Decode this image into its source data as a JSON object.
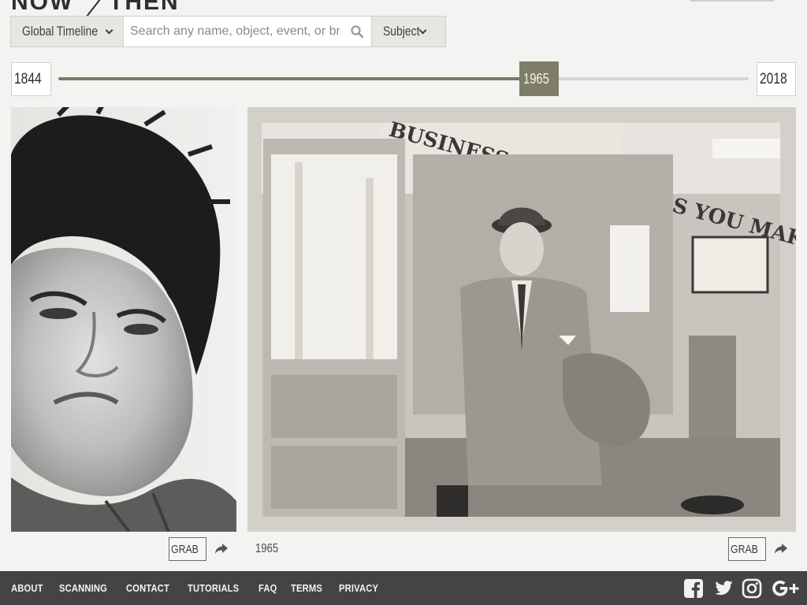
{
  "logo": {
    "word1": "NOW",
    "word2": "THEN"
  },
  "search": {
    "timeline_label": "Global Timeline",
    "placeholder": "Search any name, object, event, or brand",
    "value": "",
    "subject_label": "Subject"
  },
  "timeline": {
    "start_year": "1844",
    "end_year": "2018",
    "current_year": "1965",
    "position_fraction": 0.696
  },
  "photos": [
    {
      "name": "portrait-photo",
      "grab_label": "GRAB"
    },
    {
      "name": "office-photo",
      "year": "1965",
      "banner_text": "BUSINESS IS AS GOOD AS YOU MAKE IT!",
      "grab_label": "GRAB"
    }
  ],
  "footer": {
    "links": [
      "ABOUT",
      "SCANNING",
      "CONTACT",
      "TUTORIALS",
      "FAQ",
      "TERMS",
      "PRIVACY"
    ],
    "social": [
      "facebook-icon",
      "twitter-icon",
      "instagram-icon",
      "google-plus-icon"
    ]
  },
  "colors": {
    "accent": "#7d7d68",
    "footer_bg": "#444444",
    "page_bg": "#f3f3f1"
  }
}
